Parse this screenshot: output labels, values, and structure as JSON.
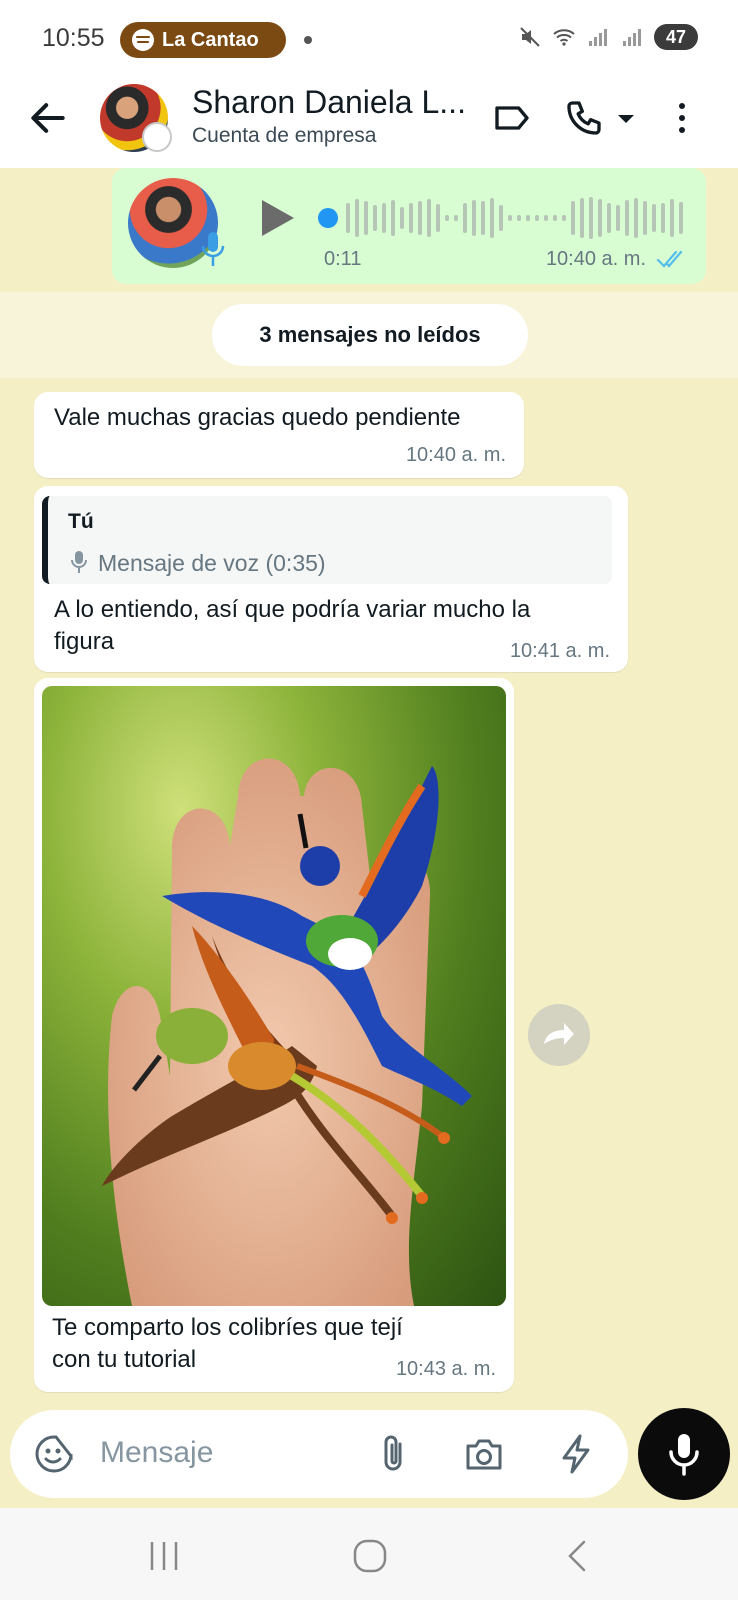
{
  "status_bar": {
    "time": "10:55",
    "media_app": "La Cantao",
    "battery": "47"
  },
  "header": {
    "contact_name": "Sharon Daniela L...",
    "subtitle": "Cuenta de empresa"
  },
  "voice_message": {
    "duration": "0:11",
    "time": "10:40 a. m.",
    "tick_color": "#53bdeb"
  },
  "unread_banner": "3 mensajes no leídos",
  "messages": [
    {
      "text": "Vale muchas gracias quedo pendiente",
      "time": "10:40 a. m."
    },
    {
      "reply_author": "Tú",
      "reply_text": "Mensaje de voz (0:35)",
      "text_line1": "A lo entiendo, así que podría variar mucho la",
      "text_line2": "figura",
      "time": "10:41 a. m."
    },
    {
      "image": "beaded-hummingbirds-photo",
      "caption_line1": "Te comparto los colibríes que tejí",
      "caption_line2": "con tu tutorial",
      "time": "10:43 a. m."
    }
  ],
  "composer": {
    "placeholder": "Mensaje"
  },
  "colors": {
    "chat_background": "#f5efc6",
    "outgoing_bubble": "#d9fdd3",
    "incoming_bubble": "#ffffff",
    "spotify_pill": "#7b4a12"
  }
}
